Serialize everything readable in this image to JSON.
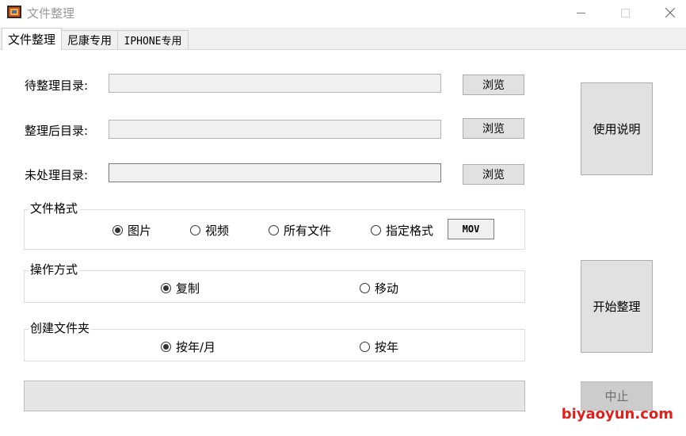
{
  "window": {
    "title": "文件整理"
  },
  "tabs": [
    {
      "label": "文件整理",
      "active": true
    },
    {
      "label": "尼康专用",
      "active": false
    },
    {
      "label": "IPHONE专用",
      "active": false
    }
  ],
  "directories": {
    "source_label": "待整理目录:",
    "target_label": "整理后目录:",
    "unprocessed_label": "未处理目录:",
    "browse_label": "浏览"
  },
  "file_format": {
    "title": "文件格式",
    "options": [
      "图片",
      "视频",
      "所有文件",
      "指定格式"
    ],
    "selected": "图片",
    "custom_value": "MOV"
  },
  "operation": {
    "title": "操作方式",
    "options": [
      "复制",
      "移动"
    ],
    "selected": "复制"
  },
  "create_folder": {
    "title": "创建文件夹",
    "options": [
      "按年/月",
      "按年"
    ],
    "selected": "按年/月"
  },
  "buttons": {
    "help": "使用说明",
    "start": "开始整理",
    "stop": "中止"
  },
  "progress": {
    "value": 0
  },
  "watermark": "biyaoyun.com"
}
